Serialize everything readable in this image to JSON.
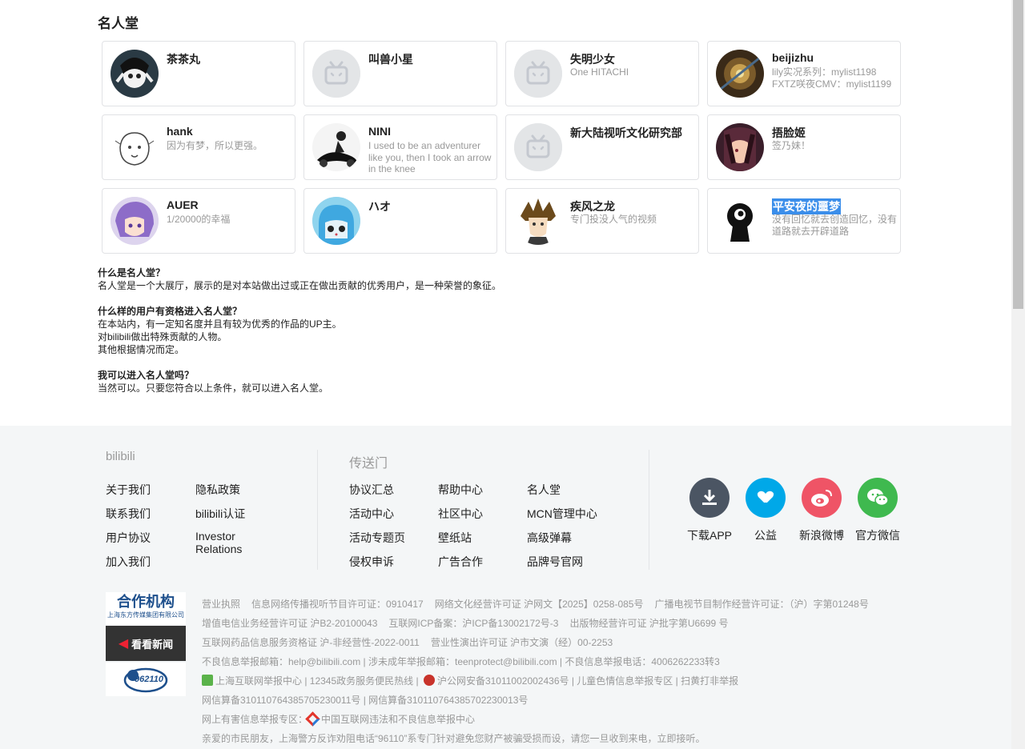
{
  "page": {
    "title": "名人堂"
  },
  "cards": [
    {
      "name": "茶茶丸",
      "desc": ""
    },
    {
      "name": "叫兽小星",
      "desc": ""
    },
    {
      "name": "失明少女",
      "desc": "One HITACHI"
    },
    {
      "name": "beijizhu",
      "desc": "lily实况系列：mylist1198 FXTZ咲夜CMV：mylist1199"
    },
    {
      "name": "hank",
      "desc": "因为有梦，所以更强。"
    },
    {
      "name": "NINI",
      "desc": "I used to be an adventurer like you, then I took an arrow in the knee"
    },
    {
      "name": "新大陆视听文化研究部",
      "desc": ""
    },
    {
      "name": "捂脸姬",
      "desc": "签乃妹！"
    },
    {
      "name": "AUER",
      "desc": "1/20000的幸福"
    },
    {
      "name": "ハオ",
      "desc": ""
    },
    {
      "name": "疾风之龙",
      "desc": "专门投没人气的视频"
    },
    {
      "name": "平安夜的噩梦",
      "desc": "没有回忆就去创造回忆，没有道路就去开辟道路"
    }
  ],
  "faq": [
    {
      "q": "什么是名人堂？",
      "a": [
        "名人堂是一个大展厅，展示的是对本站做出过或正在做出贡献的优秀用户，是一种荣誉的象征。"
      ]
    },
    {
      "q": "什么样的用户有资格进入名人堂？",
      "a": [
        "在本站内，有一定知名度并且有较为优秀的作品的UP主。",
        "对bilibili做出特殊贡献的人物。",
        "其他根据情况而定。"
      ]
    },
    {
      "q": "我可以进入名人堂吗？",
      "a": [
        "当然可以。只要您符合以上条件，就可以进入名人堂。"
      ]
    }
  ],
  "footer": {
    "col1_title": "bilibili",
    "col1_links": [
      "关于我们",
      "隐私政策",
      "联系我们",
      "bilibili认证",
      "用户协议",
      "Investor Relations",
      "加入我们"
    ],
    "col2_title": "传送门",
    "col2_links": [
      "协议汇总",
      "帮助中心",
      "名人堂",
      "活动中心",
      "社区中心",
      "MCN管理中心",
      "活动专题页",
      "壁纸站",
      "高级弹幕",
      "侵权申诉",
      "广告合作",
      "品牌号官网"
    ],
    "social": [
      {
        "label": "下载APP",
        "color": "#4b5563"
      },
      {
        "label": "公益",
        "color": "#00a8e8"
      },
      {
        "label": "新浪微博",
        "color": "#ef5466"
      },
      {
        "label": "官方微信",
        "color": "#3fb94f"
      }
    ],
    "partner": {
      "title": "合作机构",
      "sub": "上海东方传媒集团有限公司",
      "kankan": "看看新闻",
      "police": "962110"
    },
    "lic": [
      [
        "营业执照",
        "信息网络传播视听节目许可证：0910417",
        "网络文化经营许可证 沪网文【2025】0258-085号",
        "广播电视节目制作经营许可证：（沪）字第01248号"
      ],
      [
        "增值电信业务经营许可证 沪B2-20100043",
        "互联网ICP备案：沪ICP备13002172号-3",
        "出版物经营许可证 沪批字第U6699 号"
      ],
      [
        "互联网药品信息服务资格证 沪-非经营性-2022-0011",
        "营业性演出许可证 沪市文演（经）00-2253"
      ],
      [
        "不良信息举报邮箱：help@bilibili.com | 涉未成年举报邮箱：teenprotect@bilibili.com | 不良信息举报电话：4006262233转3"
      ],
      [
        "上海互联网举报中心 | 12345政务服务便民热线 | ",
        "沪公网安备31011002002436号 | 儿童色情信息举报专区 | 扫黄打非举报"
      ],
      [
        "网信算备310110764385705230011号 | 网信算备310110764385702230013号"
      ],
      [
        "网上有害信息举报专区：",
        "中国互联网违法和不良信息举报中心"
      ],
      [
        "亲爱的市民朋友，上海警方反诈劝阻电话“96110”系专门针对避免您财产被骗受损而设，请您一旦收到来电，立即接听。"
      ]
    ]
  }
}
